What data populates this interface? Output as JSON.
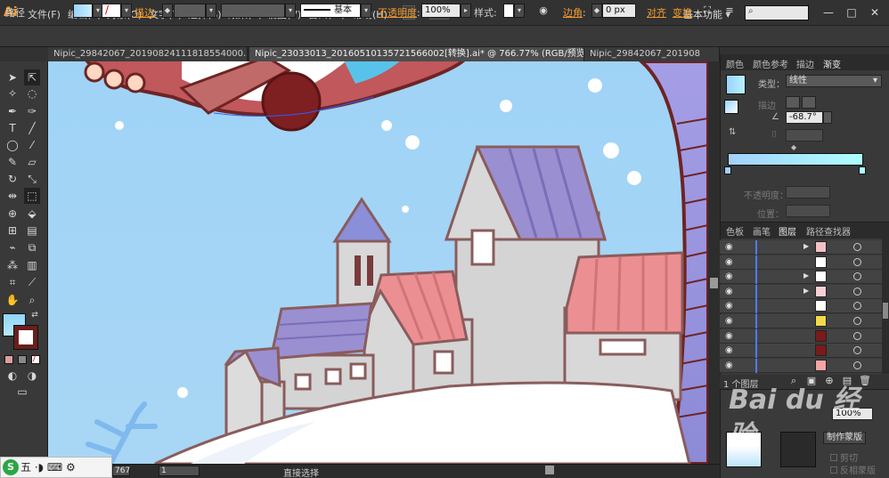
{
  "app": {
    "logo": "Ai"
  },
  "menu": [
    "文件(F)",
    "编辑(E)",
    "对象(O)",
    "文字(T)",
    "选择(S)",
    "效果(C)",
    "视图(V)",
    "窗口(W)",
    "帮助(H)"
  ],
  "workspace": {
    "label": "基本功能",
    "arrow": "▾"
  },
  "window_controls": [
    "—",
    "□",
    "✕"
  ],
  "control_bar": {
    "object_type": "路径",
    "stroke_label": "描边",
    "stroke_style": "基本",
    "opacity_label": "不透明度",
    "opacity_value": "100%",
    "style_label": "样式",
    "corner_label": "边角",
    "corner_value": "0 px",
    "align_link": "对齐",
    "transform_link": "变换"
  },
  "document_tabs": [
    {
      "label": "Nipic_29842067_20190824111818554000.ai*",
      "close": "×",
      "active": false
    },
    {
      "label": "Nipic_23033013_20160510135721566002[转换].ai* @ 766.77% (RGB/预览)",
      "close": "×",
      "active": true
    },
    {
      "label": "Nipic_29842067_201908",
      "close": "",
      "active": false
    }
  ],
  "gradient_panel": {
    "tabs": [
      "颜色",
      "颜色参考",
      "描边",
      "渐变"
    ],
    "active_tab": "渐变",
    "type_label": "类型：",
    "type_value": "线性",
    "stroke_label": "描边",
    "angle_value": "-68.7°",
    "opacity_label": "不透明度：",
    "position_label": "位置："
  },
  "layers_panel": {
    "tabs": [
      "色板",
      "画笔",
      "图层",
      "路径查找器"
    ],
    "active_tab": "图层",
    "rows": [
      {
        "expand": "▶",
        "thumb": "#f3c0c6"
      },
      {
        "expand": "",
        "thumb": "#ffffff"
      },
      {
        "expand": "▶",
        "thumb": "#ffffff"
      },
      {
        "expand": "▶",
        "thumb": "#f6d0d5"
      },
      {
        "expand": "",
        "thumb": "#ffffff"
      },
      {
        "expand": "",
        "thumb": "#f1d94a"
      },
      {
        "expand": "",
        "thumb": "#7a1a1a"
      },
      {
        "expand": "",
        "thumb": "#7a1a1a"
      },
      {
        "expand": "",
        "thumb": "#f4a5a5"
      }
    ],
    "count": "1 个图层"
  },
  "transparency_panel": {
    "opacity_value": "100%",
    "mask_button": "制作蒙版",
    "clip_label": "剪切",
    "invert_label": "反相蒙版"
  },
  "watermark": "Bai du 经验",
  "status_bar": {
    "zoom_value": "767",
    "page_value": "1",
    "tool_name": "直接选择"
  },
  "ime": {
    "label": "五"
  },
  "colors": {
    "sky": "#9fd6f6",
    "outline": "#7a3b3b",
    "roof_purple": "#9a8fd0",
    "roof_pink": "#ec8f92",
    "wall": "#d8d8d8",
    "snow": "#ffffff",
    "accent_orange": "#f29a2e"
  }
}
